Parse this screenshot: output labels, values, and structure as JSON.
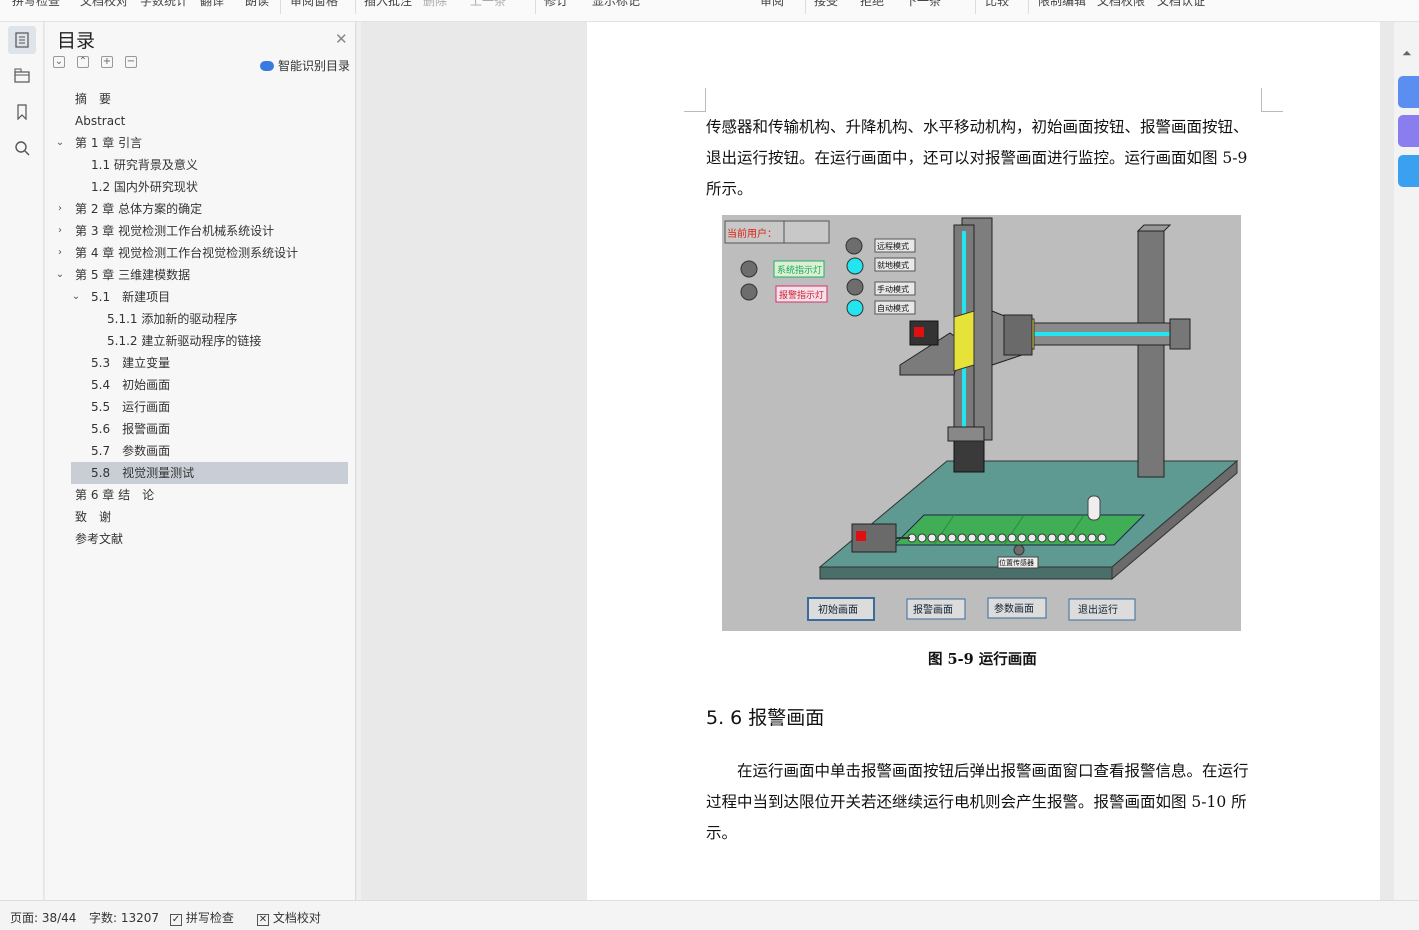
{
  "toolbar": {
    "spell_check": "拼写检查",
    "doc_proof": "文档校对",
    "word_count": "字数统计",
    "translate": "翻译",
    "read_aloud": "朗读",
    "comment_pane": "审阅窗格",
    "insert_comment": "插入批注",
    "delete": "删除",
    "prev": "上一条",
    "track_changes": "修订",
    "show_markup": "显示标记",
    "review": "审阅",
    "accept": "接受",
    "reject": "拒绝",
    "next": "下一条",
    "compare": "比较",
    "restrict_editing": "限制编辑",
    "doc_permission": "文档权限",
    "doc_certify": "文档认证"
  },
  "toc": {
    "title": "目录",
    "smart_label": "智能识别目录",
    "items": [
      {
        "label": "摘　要",
        "level": 0,
        "arrow": ""
      },
      {
        "label": "Abstract",
        "level": 0,
        "arrow": ""
      },
      {
        "label": "第 1 章  引言",
        "level": 0,
        "arrow": "down"
      },
      {
        "label": "1.1 研究背景及意义",
        "level": 1,
        "arrow": ""
      },
      {
        "label": "1.2 国内外研究现状",
        "level": 1,
        "arrow": ""
      },
      {
        "label": "第 2 章  总体方案的确定",
        "level": 0,
        "arrow": "right"
      },
      {
        "label": "第 3 章  视觉检测工作台机械系统设计",
        "level": 0,
        "arrow": "right"
      },
      {
        "label": "第 4 章  视觉检测工作台视觉检测系统设计",
        "level": 0,
        "arrow": "right"
      },
      {
        "label": "第 5 章  三维建模数据",
        "level": 0,
        "arrow": "down"
      },
      {
        "label": "5.1　新建项目",
        "level": 1,
        "arrow": "down"
      },
      {
        "label": "5.1.1  添加新的驱动程序",
        "level": 2,
        "arrow": ""
      },
      {
        "label": "5.1.2  建立新驱动程序的链接",
        "level": 2,
        "arrow": ""
      },
      {
        "label": "5.3　建立变量",
        "level": 1,
        "arrow": ""
      },
      {
        "label": "5.4　初始画面",
        "level": 1,
        "arrow": ""
      },
      {
        "label": "5.5　运行画面",
        "level": 1,
        "arrow": ""
      },
      {
        "label": "5.6　报警画面",
        "level": 1,
        "arrow": ""
      },
      {
        "label": "5.7　参数画面",
        "level": 1,
        "arrow": ""
      },
      {
        "label": "5.8　视觉测量测试",
        "level": 1,
        "arrow": "",
        "selected": true
      },
      {
        "label": "第 6 章  结　论",
        "level": 0,
        "arrow": ""
      },
      {
        "label": "致　谢",
        "level": 0,
        "arrow": ""
      },
      {
        "label": "参考文献",
        "level": 0,
        "arrow": ""
      }
    ]
  },
  "doc": {
    "para1_line1": "传感器和传输机构、升降机构、水平移动机构，初始画面按钮、报警画面按钮、",
    "para1_line2": "退出运行按钮。在运行画面中，还可以对报警画面进行监控。运行画面如图 5-9",
    "para1_line3": "所示。",
    "figure_caption": "图 5-9  运行画面",
    "section_heading": "5. 6    报警画面",
    "para2_line1": "　　在运行画面中单击报警画面按钮后弹出报警画面窗口查看报警信息。在运行",
    "para2_line2": "过程中当到达限位开关若还继续运行电机则会产生报警。报警画面如图 5-10 所",
    "para2_line3": "示。"
  },
  "figure": {
    "current_user": "当前用户：",
    "system_light": "系统指示灯",
    "alarm_light": "报警指示灯",
    "mode_remote": "远程模式",
    "mode_local": "就地模式",
    "mode_manual": "手动模式",
    "mode_auto": "自动模式",
    "position_sensor": "位置传感器",
    "btn_initial": "初始画面",
    "btn_alarm": "报警画面",
    "btn_param": "参数画面",
    "btn_exit": "退出运行"
  },
  "status": {
    "page": "页面: 38/44",
    "words": "字数: 13207",
    "spell": "拼写检查",
    "proof": "文档校对"
  }
}
